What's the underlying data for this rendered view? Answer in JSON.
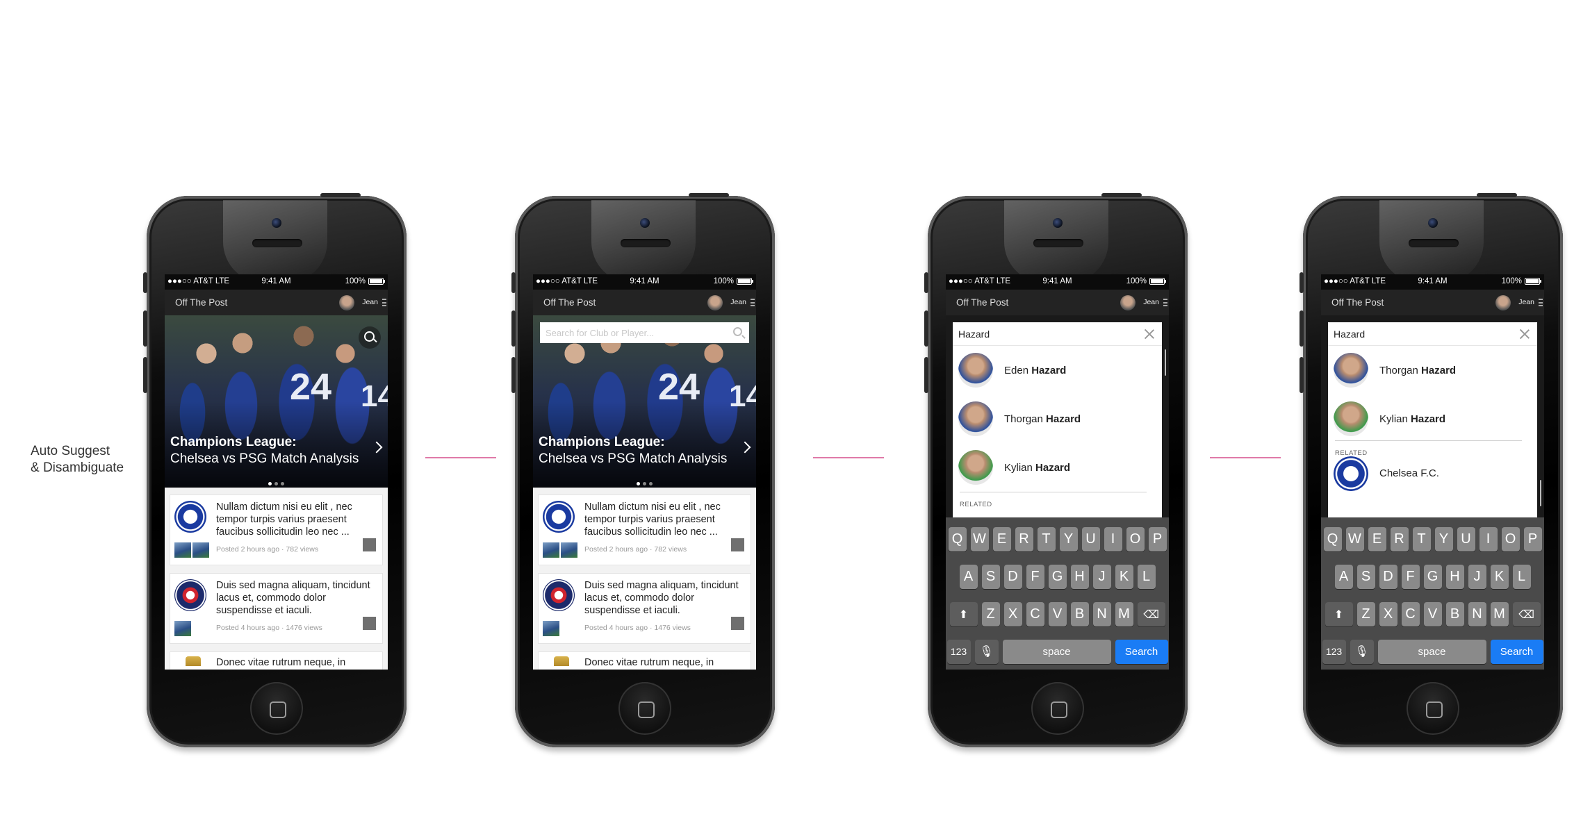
{
  "caption": {
    "line1": "Auto Suggest",
    "line2": "& Disambiguate"
  },
  "status": {
    "carrier": "●●●○○ AT&T  LTE",
    "time": "9:41 AM",
    "battery": "100%"
  },
  "nav": {
    "title": "Off The Post",
    "user": "Jean"
  },
  "hero": {
    "headline": "Champions League:",
    "subhead": "Chelsea vs PSG Match Analysis",
    "search_placeholder": "Search for Club or Player..."
  },
  "feed": [
    {
      "text": "Nullam dictum nisi eu elit , nec tempor turpis varius praesent faucibus sollicitudin leo nec ...",
      "meta": "Posted 2 hours ago · 782 views"
    },
    {
      "text": "Duis sed magna aliquam, tincidunt lacus et, commodo dolor suspendisse et iaculi.",
      "meta": "Posted 4 hours ago · 1476 views"
    },
    {
      "text": "Donec vitae rutrum neque, in"
    }
  ],
  "search": {
    "query": "Hazard",
    "results_a": [
      {
        "first": "Eden",
        "last": "Hazard"
      },
      {
        "first": "Thorgan",
        "last": "Hazard"
      },
      {
        "first": "Kylian",
        "last": "Hazard"
      }
    ],
    "results_b": [
      {
        "first": "Thorgan",
        "last": "Hazard"
      },
      {
        "first": "Kylian",
        "last": "Hazard"
      }
    ],
    "related_label": "RELATED",
    "related_club": "Chelsea F.C."
  },
  "keyboard": {
    "row1": [
      "Q",
      "W",
      "E",
      "R",
      "T",
      "Y",
      "U",
      "I",
      "O",
      "P"
    ],
    "row2": [
      "A",
      "S",
      "D",
      "F",
      "G",
      "H",
      "J",
      "K",
      "L"
    ],
    "row3": [
      "Z",
      "X",
      "C",
      "V",
      "B",
      "N",
      "M"
    ],
    "num": "123",
    "mic": "🎙",
    "space": "space",
    "action": "Search"
  },
  "colors": {
    "connector": "#e07aa8",
    "search_key": "#1a7cf5"
  }
}
